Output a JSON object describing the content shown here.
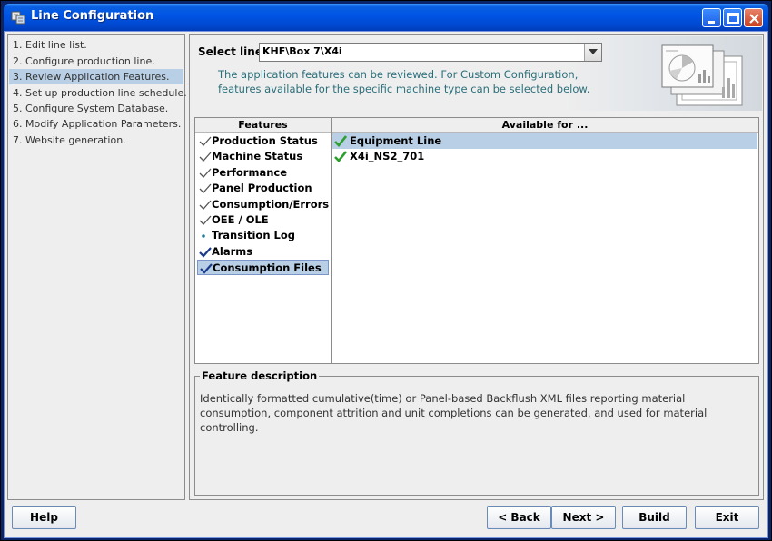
{
  "window": {
    "title": "Line Configuration"
  },
  "steps": [
    "1. Edit line list.",
    "2. Configure production line.",
    "3. Review Application Features.",
    "4. Set up production line schedule.",
    "5. Configure System Database.",
    "6. Modify Application Parameters.",
    "7. Website generation."
  ],
  "active_step_index": 2,
  "select_line": {
    "label": "Select line:",
    "value": "KHF\\Box 7\\X4i"
  },
  "info_text": "The application features can be reviewed. For Custom Configuration, features available for the specific machine type can be selected below.",
  "features": {
    "header": "Features",
    "items": [
      {
        "label": "Production Status",
        "icon": "check-outline-icon"
      },
      {
        "label": "Machine Status",
        "icon": "check-outline-icon"
      },
      {
        "label": "Performance",
        "icon": "check-outline-icon"
      },
      {
        "label": "Panel Production",
        "icon": "check-outline-icon"
      },
      {
        "label": "Consumption/Errors",
        "icon": "check-outline-icon"
      },
      {
        "label": "OEE / OLE",
        "icon": "check-outline-icon"
      },
      {
        "label": "Transition Log",
        "icon": "dot-icon"
      },
      {
        "label": "Alarms",
        "icon": "check-solid-icon"
      },
      {
        "label": "Consumption Files",
        "icon": "check-solid-icon"
      }
    ],
    "selected_index": 8
  },
  "available": {
    "header": "Available for ...",
    "items": [
      {
        "label": "Equipment Line",
        "icon": "green-check-icon"
      },
      {
        "label": "X4i_NS2_701",
        "icon": "green-check-icon"
      }
    ],
    "selected_index": 0
  },
  "description": {
    "legend": "Feature description",
    "text": "Identically formatted cumulative(time) or Panel-based Backflush XML files reporting material consumption, component attrition and unit completions can be generated, and used for material controlling."
  },
  "buttons": {
    "help": "Help",
    "back": "< Back",
    "next": "Next >",
    "build": "Build",
    "exit": "Exit"
  },
  "colors": {
    "selection": "#b8cfe5",
    "info_text": "#2a6f7a",
    "check_green": "#2e9e2e"
  }
}
